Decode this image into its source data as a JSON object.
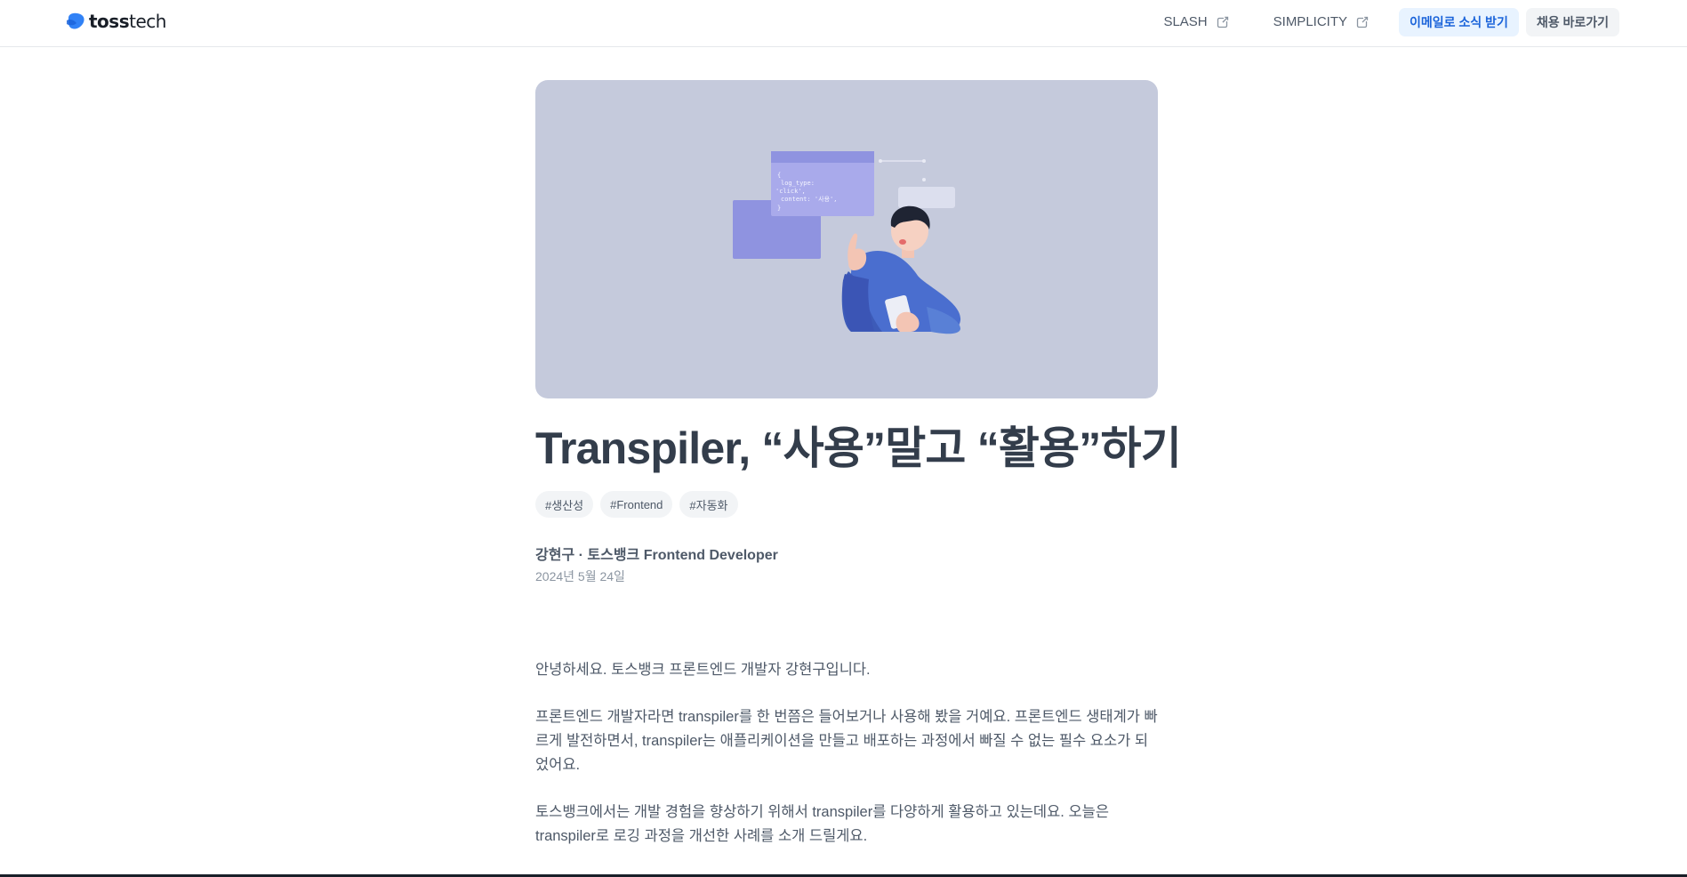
{
  "header": {
    "logo_bold": "toss",
    "logo_light": "tech",
    "nav_links": [
      {
        "label": "SLASH",
        "icon": "external-link-icon"
      },
      {
        "label": "SIMPLICITY",
        "icon": "external-link-icon"
      }
    ],
    "subscribe_button": "이메일로 소식 받기",
    "careers_button": "채용 바로가기"
  },
  "hero": {
    "code_lines": [
      "{",
      "  log_type:",
      "'click',",
      "  content: '사용',",
      "}"
    ],
    "background_color": "#c5cadc"
  },
  "article": {
    "title": "Transpiler, “사용”말고 “활용”하기",
    "tags": [
      "#생산성",
      "#Frontend",
      "#자동화"
    ],
    "author": "강현구 · 토스뱅크 Frontend Developer",
    "date": "2024년 5월 24일",
    "paragraphs": [
      "안녕하세요. 토스뱅크 프론트엔드 개발자 강현구입니다.",
      "프론트엔드 개발자라면 transpiler를 한 번쯤은 들어보거나 사용해 봤을 거예요. 프론트엔드 생태계가 빠르게 발전하면서, transpiler는 애플리케이션을 만들고 배포하는 과정에서 빠질 수 없는 필수 요소가 되었어요.",
      "토스뱅크에서는 개발 경험을 향상하기 위해서 transpiler를 다양하게 활용하고 있는데요. 오늘은 transpiler로 로깅 과정을 개선한 사례를 소개 드릴게요."
    ]
  },
  "colors": {
    "brand_blue": "#3182f6",
    "text_primary": "#333d4b",
    "text_secondary": "#4e5968"
  }
}
